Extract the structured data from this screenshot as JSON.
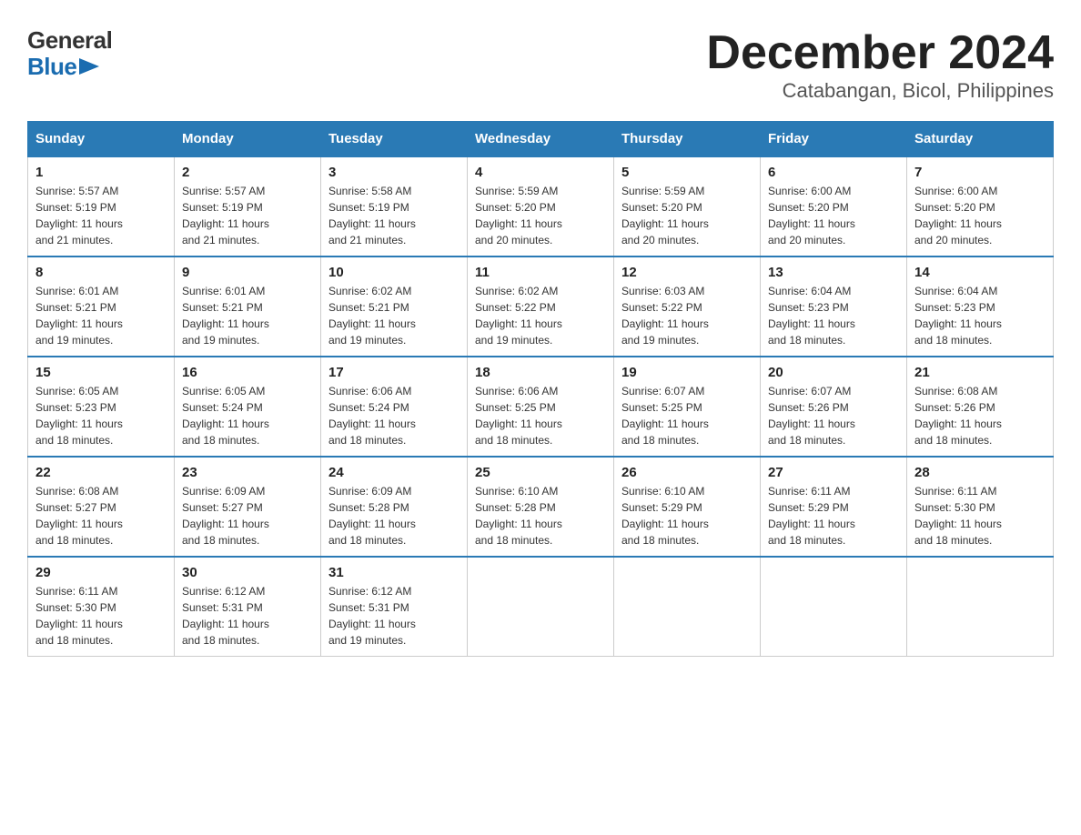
{
  "header": {
    "title": "December 2024",
    "subtitle": "Catabangan, Bicol, Philippines",
    "logo_top": "General",
    "logo_bottom": "Blue"
  },
  "days_of_week": [
    "Sunday",
    "Monday",
    "Tuesday",
    "Wednesday",
    "Thursday",
    "Friday",
    "Saturday"
  ],
  "weeks": [
    [
      {
        "num": "1",
        "info": "Sunrise: 5:57 AM\nSunset: 5:19 PM\nDaylight: 11 hours\nand 21 minutes."
      },
      {
        "num": "2",
        "info": "Sunrise: 5:57 AM\nSunset: 5:19 PM\nDaylight: 11 hours\nand 21 minutes."
      },
      {
        "num": "3",
        "info": "Sunrise: 5:58 AM\nSunset: 5:19 PM\nDaylight: 11 hours\nand 21 minutes."
      },
      {
        "num": "4",
        "info": "Sunrise: 5:59 AM\nSunset: 5:20 PM\nDaylight: 11 hours\nand 20 minutes."
      },
      {
        "num": "5",
        "info": "Sunrise: 5:59 AM\nSunset: 5:20 PM\nDaylight: 11 hours\nand 20 minutes."
      },
      {
        "num": "6",
        "info": "Sunrise: 6:00 AM\nSunset: 5:20 PM\nDaylight: 11 hours\nand 20 minutes."
      },
      {
        "num": "7",
        "info": "Sunrise: 6:00 AM\nSunset: 5:20 PM\nDaylight: 11 hours\nand 20 minutes."
      }
    ],
    [
      {
        "num": "8",
        "info": "Sunrise: 6:01 AM\nSunset: 5:21 PM\nDaylight: 11 hours\nand 19 minutes."
      },
      {
        "num": "9",
        "info": "Sunrise: 6:01 AM\nSunset: 5:21 PM\nDaylight: 11 hours\nand 19 minutes."
      },
      {
        "num": "10",
        "info": "Sunrise: 6:02 AM\nSunset: 5:21 PM\nDaylight: 11 hours\nand 19 minutes."
      },
      {
        "num": "11",
        "info": "Sunrise: 6:02 AM\nSunset: 5:22 PM\nDaylight: 11 hours\nand 19 minutes."
      },
      {
        "num": "12",
        "info": "Sunrise: 6:03 AM\nSunset: 5:22 PM\nDaylight: 11 hours\nand 19 minutes."
      },
      {
        "num": "13",
        "info": "Sunrise: 6:04 AM\nSunset: 5:23 PM\nDaylight: 11 hours\nand 18 minutes."
      },
      {
        "num": "14",
        "info": "Sunrise: 6:04 AM\nSunset: 5:23 PM\nDaylight: 11 hours\nand 18 minutes."
      }
    ],
    [
      {
        "num": "15",
        "info": "Sunrise: 6:05 AM\nSunset: 5:23 PM\nDaylight: 11 hours\nand 18 minutes."
      },
      {
        "num": "16",
        "info": "Sunrise: 6:05 AM\nSunset: 5:24 PM\nDaylight: 11 hours\nand 18 minutes."
      },
      {
        "num": "17",
        "info": "Sunrise: 6:06 AM\nSunset: 5:24 PM\nDaylight: 11 hours\nand 18 minutes."
      },
      {
        "num": "18",
        "info": "Sunrise: 6:06 AM\nSunset: 5:25 PM\nDaylight: 11 hours\nand 18 minutes."
      },
      {
        "num": "19",
        "info": "Sunrise: 6:07 AM\nSunset: 5:25 PM\nDaylight: 11 hours\nand 18 minutes."
      },
      {
        "num": "20",
        "info": "Sunrise: 6:07 AM\nSunset: 5:26 PM\nDaylight: 11 hours\nand 18 minutes."
      },
      {
        "num": "21",
        "info": "Sunrise: 6:08 AM\nSunset: 5:26 PM\nDaylight: 11 hours\nand 18 minutes."
      }
    ],
    [
      {
        "num": "22",
        "info": "Sunrise: 6:08 AM\nSunset: 5:27 PM\nDaylight: 11 hours\nand 18 minutes."
      },
      {
        "num": "23",
        "info": "Sunrise: 6:09 AM\nSunset: 5:27 PM\nDaylight: 11 hours\nand 18 minutes."
      },
      {
        "num": "24",
        "info": "Sunrise: 6:09 AM\nSunset: 5:28 PM\nDaylight: 11 hours\nand 18 minutes."
      },
      {
        "num": "25",
        "info": "Sunrise: 6:10 AM\nSunset: 5:28 PM\nDaylight: 11 hours\nand 18 minutes."
      },
      {
        "num": "26",
        "info": "Sunrise: 6:10 AM\nSunset: 5:29 PM\nDaylight: 11 hours\nand 18 minutes."
      },
      {
        "num": "27",
        "info": "Sunrise: 6:11 AM\nSunset: 5:29 PM\nDaylight: 11 hours\nand 18 minutes."
      },
      {
        "num": "28",
        "info": "Sunrise: 6:11 AM\nSunset: 5:30 PM\nDaylight: 11 hours\nand 18 minutes."
      }
    ],
    [
      {
        "num": "29",
        "info": "Sunrise: 6:11 AM\nSunset: 5:30 PM\nDaylight: 11 hours\nand 18 minutes."
      },
      {
        "num": "30",
        "info": "Sunrise: 6:12 AM\nSunset: 5:31 PM\nDaylight: 11 hours\nand 18 minutes."
      },
      {
        "num": "31",
        "info": "Sunrise: 6:12 AM\nSunset: 5:31 PM\nDaylight: 11 hours\nand 19 minutes."
      },
      null,
      null,
      null,
      null
    ]
  ]
}
